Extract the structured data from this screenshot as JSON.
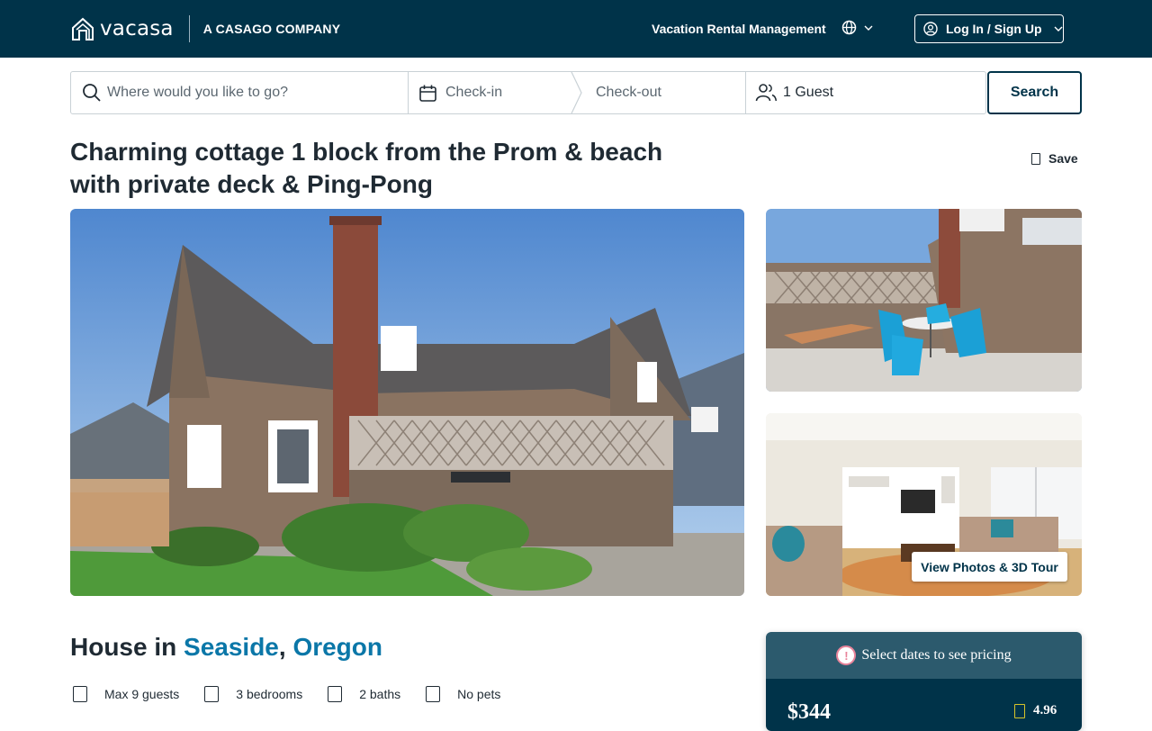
{
  "header": {
    "logo_text": "vacasa",
    "tagline": "A CASAGO COMPANY",
    "nav_link": "Vacation Rental Management",
    "login_label": "Log In / Sign Up",
    "colors": {
      "bar": "#003349",
      "text": "#ffffff"
    }
  },
  "search": {
    "where_placeholder": "Where would you like to go?",
    "checkin_placeholder": "Check-in",
    "checkout_placeholder": "Check-out",
    "guests": "1 Guest",
    "button_label": "Search"
  },
  "listing": {
    "title": "Charming cottage 1 block from the Prom & beach with private deck & Ping-Pong",
    "save_label": "Save",
    "tour_button": "View Photos & 3D Tour",
    "type_prefix": "House in",
    "city": "Seaside",
    "comma": ",",
    "state": "Oregon",
    "amenities": {
      "guests": "Max 9 guests",
      "bedrooms": "3 bedrooms",
      "baths": "2 baths",
      "pets": "No pets"
    }
  },
  "pricing": {
    "notice": "Select dates to see pricing",
    "warning_symbol": "!",
    "price": "$344",
    "rating": "4.96",
    "colors": {
      "notice_bg": "#2c5a6d",
      "price_bg": "#003349",
      "link": "#0b77a8"
    }
  }
}
